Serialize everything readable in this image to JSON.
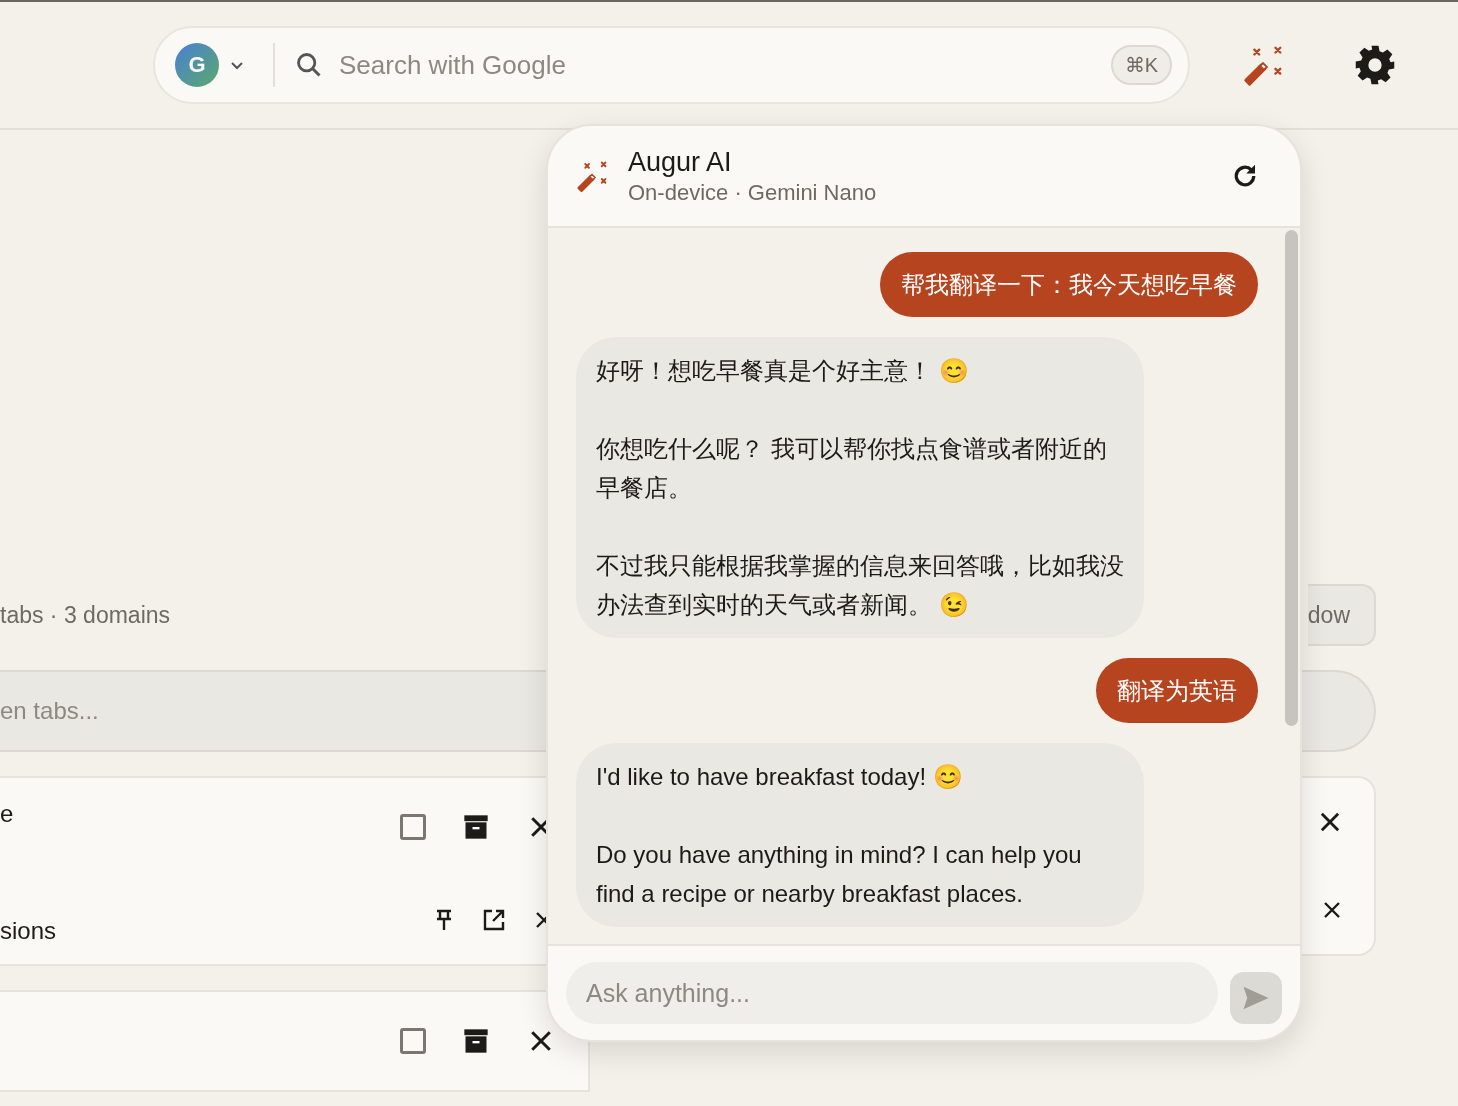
{
  "topbar": {
    "account_initial": "G",
    "search": {
      "placeholder": "Search with Google",
      "shortcut": "⌘K"
    }
  },
  "background": {
    "summary": "tabs · 3 domains",
    "window_button": "dow",
    "filter": {
      "placeholder": "en tabs..."
    },
    "groups": [
      {
        "title": "e",
        "checked": false,
        "tabs": [
          {
            "title": "sions"
          }
        ]
      },
      {
        "checked": false
      }
    ]
  },
  "assistant": {
    "title": "Augur AI",
    "subtitle": "On-device · Gemini Nano",
    "messages": [
      {
        "kind": "user",
        "text": "帮我翻译一下：我今天想吃早餐"
      },
      {
        "kind": "assistant",
        "paragraphs": [
          "好呀！想吃早餐真是个好主意！ 😊",
          "你想吃什么呢？ 我可以帮你找点食谱或者附近的早餐店。",
          "不过我只能根据我掌握的信息来回答哦，比如我没办法查到实时的天气或者新闻。 😉"
        ]
      },
      {
        "kind": "user",
        "text": "翻译为英语"
      },
      {
        "kind": "assistant",
        "paragraphs": [
          "I'd like to have breakfast today! 😊",
          "Do you have anything in mind? I can help you find a recipe or nearby breakfast places."
        ]
      }
    ],
    "input": {
      "placeholder": "Ask anything..."
    }
  }
}
